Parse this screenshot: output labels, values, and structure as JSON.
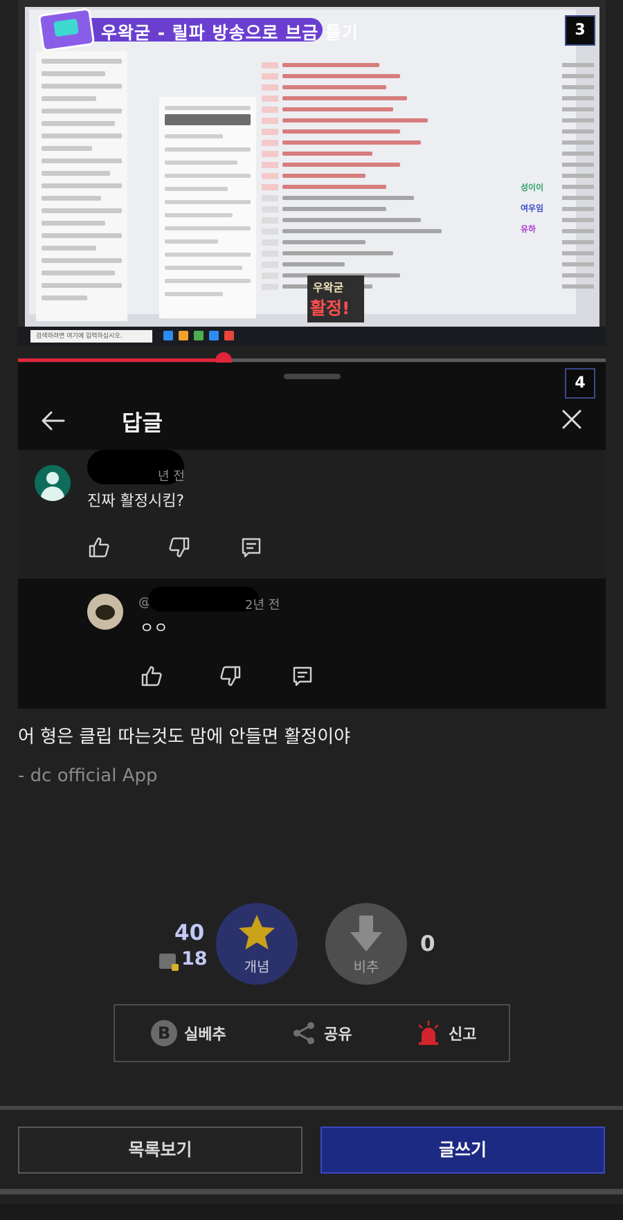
{
  "image1": {
    "stream_title": "우왁굳 - 릴파 방송으로 브금 틀기",
    "overlay_name": "우왁굳",
    "overlay_text": "활정!",
    "chat_names": [
      "성이이",
      "여우임",
      "유하"
    ],
    "chat_colors": [
      "#2fa36b",
      "#3b49c9",
      "#b13ccf"
    ],
    "taskbar_search": "검색하려면 여기에 입력하십시오.",
    "badge_number": "3"
  },
  "image2": {
    "badge_number": "4",
    "header_title": "답글",
    "comment1": {
      "time": "년 전",
      "text": "진짜 활정시킴?"
    },
    "comment2": {
      "handle_prefix": "@",
      "time": "2년 전",
      "text": "ㅇㅇ"
    },
    "icons": [
      "back-arrow-icon",
      "close-icon",
      "thumbs-up-icon",
      "thumbs-down-icon",
      "reply-icon"
    ]
  },
  "post": {
    "body": "어 형은 클립 따는것도 맘에 안들면 활정이야",
    "signature": "- dc official App"
  },
  "votes": {
    "up_count": "40",
    "fixed_count": "18",
    "up_label": "개념",
    "down_label": "비추",
    "down_count": "0"
  },
  "actions": {
    "best": "실베추",
    "best_icon_letter": "B",
    "share": "공유",
    "report": "신고"
  },
  "nav": {
    "list": "목록보기",
    "write": "글쓰기"
  },
  "colors": {
    "background": "#212121",
    "accent_blue": "#1d2a83",
    "vote_up_bg": "#2b326b",
    "star": "#c9a21a",
    "progress": "#e0243a",
    "report_red": "#d3232c"
  },
  "progress_fraction": 0.35
}
